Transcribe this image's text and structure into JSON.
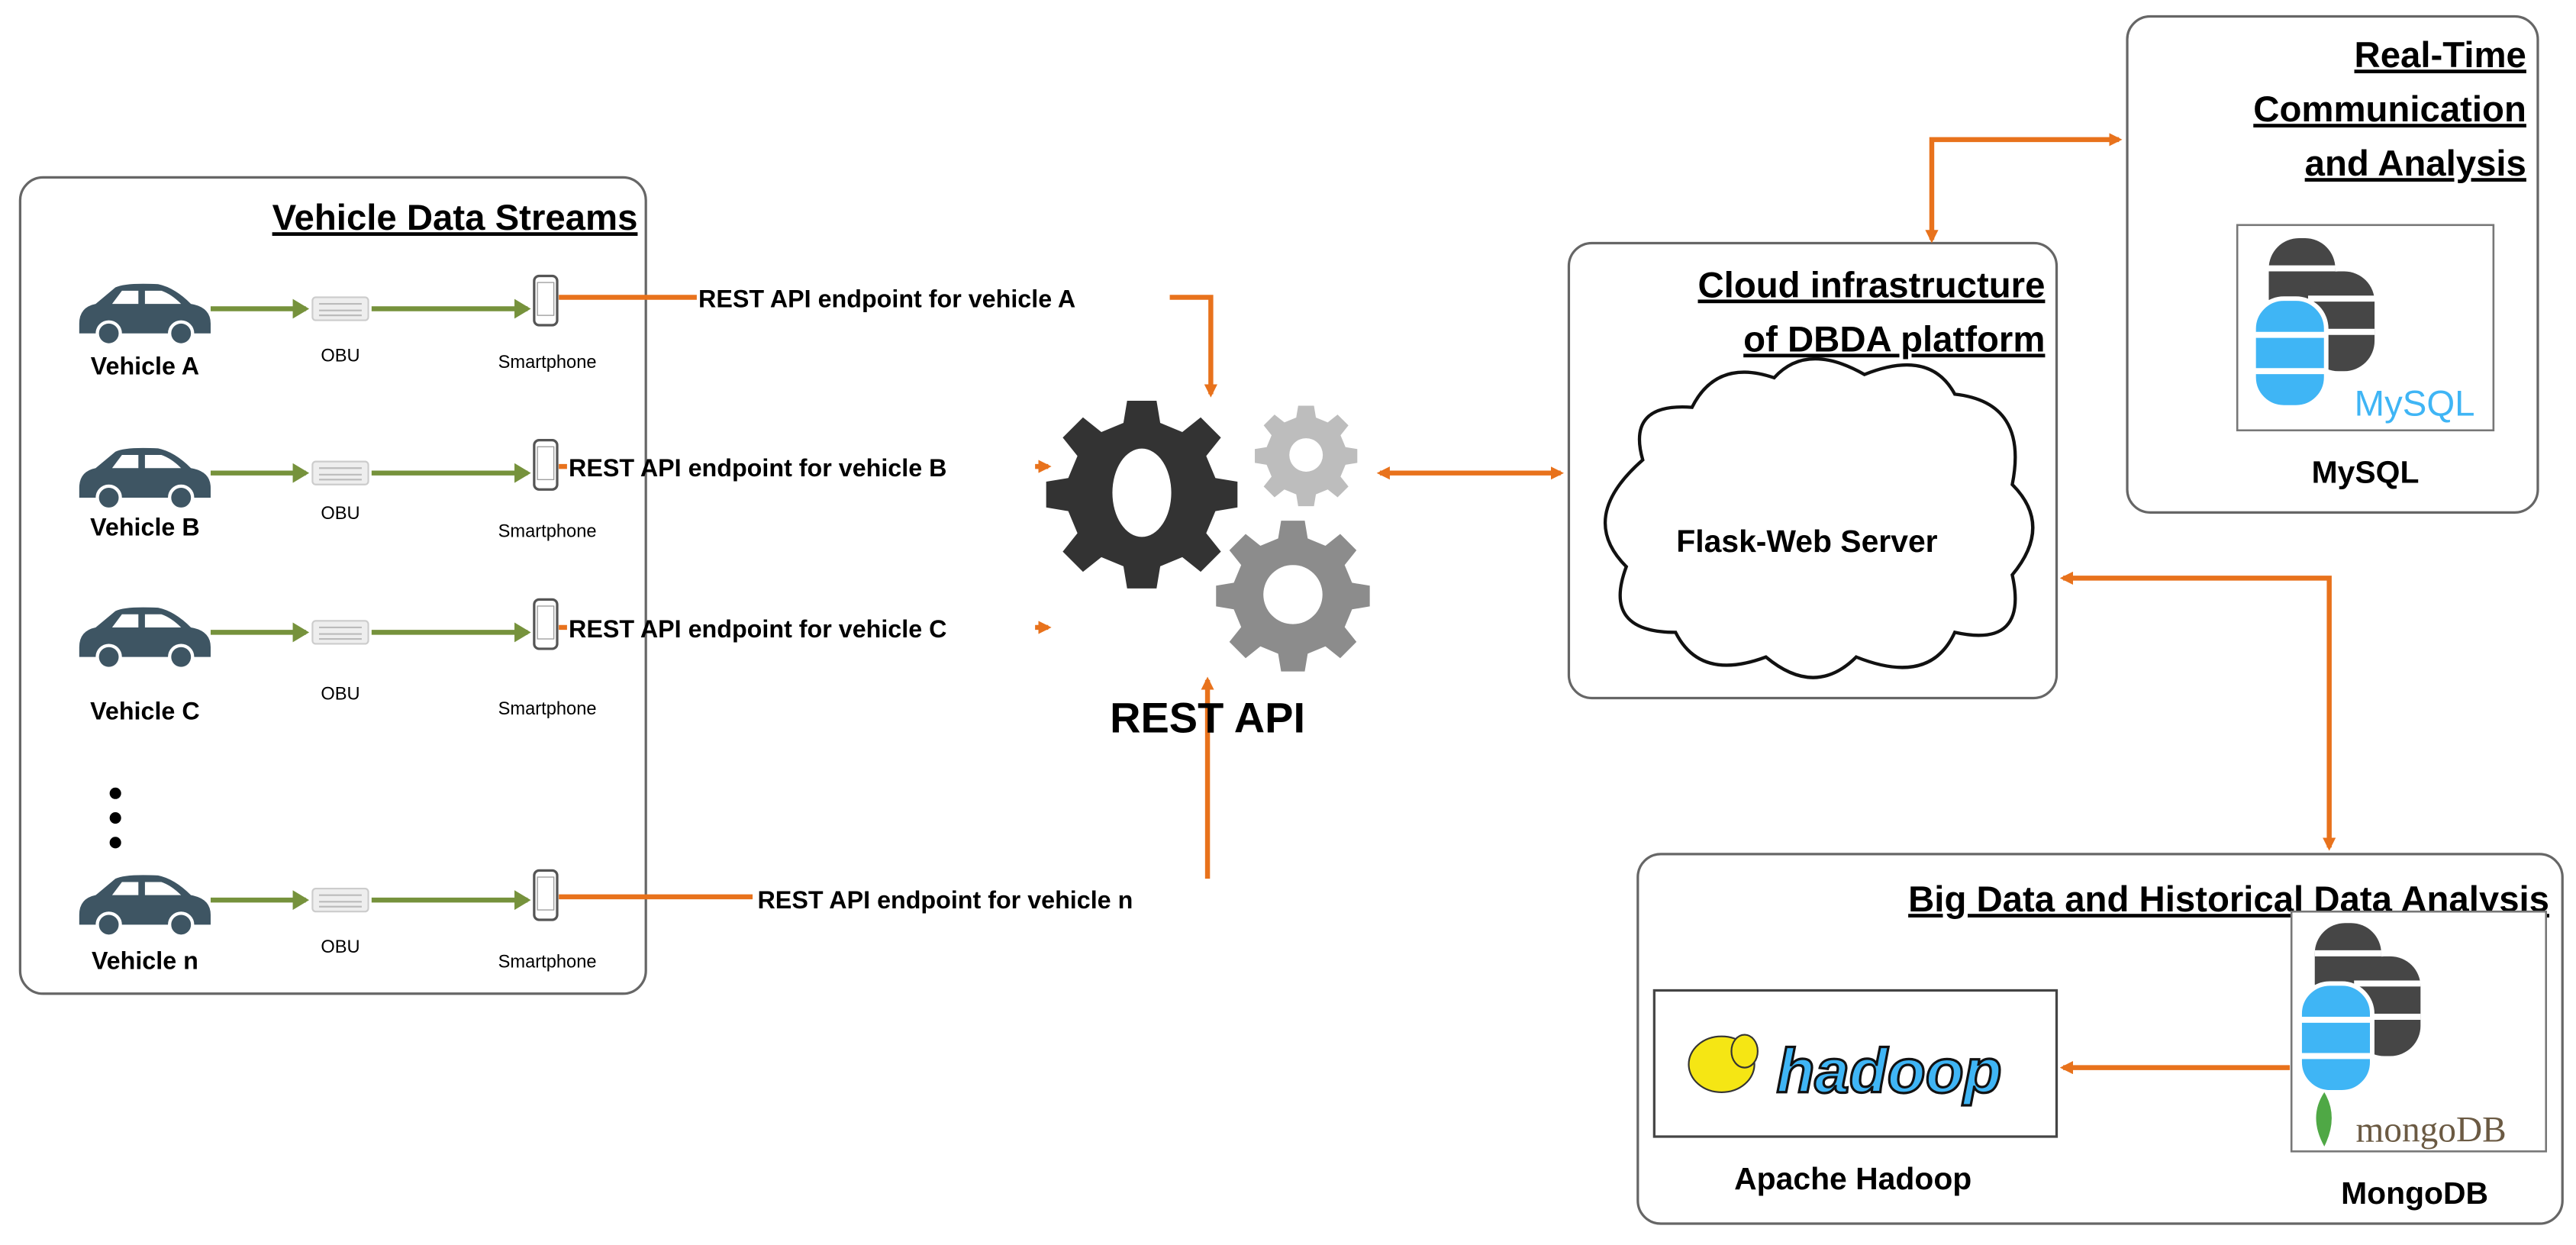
{
  "vehicle_streams": {
    "title": "Vehicle Data Streams",
    "rows": [
      {
        "vehicle": "Vehicle A",
        "obu": "OBU",
        "phone": "Smartphone",
        "endpoint": "REST API endpoint for vehicle A"
      },
      {
        "vehicle": "Vehicle B",
        "obu": "OBU",
        "phone": "Smartphone",
        "endpoint": "REST API endpoint for vehicle B"
      },
      {
        "vehicle": "Vehicle C",
        "obu": "OBU",
        "phone": "Smartphone",
        "endpoint": "REST API endpoint for vehicle C"
      },
      {
        "vehicle": "Vehicle n",
        "obu": "OBU",
        "phone": "Smartphone",
        "endpoint": "REST API endpoint for vehicle n"
      }
    ]
  },
  "rest_api": {
    "label": "REST API"
  },
  "cloud": {
    "title_line1": "Cloud infrastructure",
    "title_line2": "of DBDA platform",
    "server": "Flask-Web Server"
  },
  "realtime": {
    "title_line1": "Real-Time",
    "title_line2": "Communication",
    "title_line3": "and Analysis",
    "db_label": "MySQL",
    "logo_text": "MySQL"
  },
  "bigdata": {
    "title": "Big Data and Historical Data Analysis",
    "hadoop_label": "Apache Hadoop",
    "hadoop_logo_text": "hadoop",
    "mongo_label": "MongoDB",
    "mongo_logo_text": "mongoDB"
  },
  "colors": {
    "arrow": "#E8721C",
    "flow": "#76923C",
    "car": "#3E5563",
    "db_blue": "#3FB5F5",
    "db_dark": "#464646"
  }
}
